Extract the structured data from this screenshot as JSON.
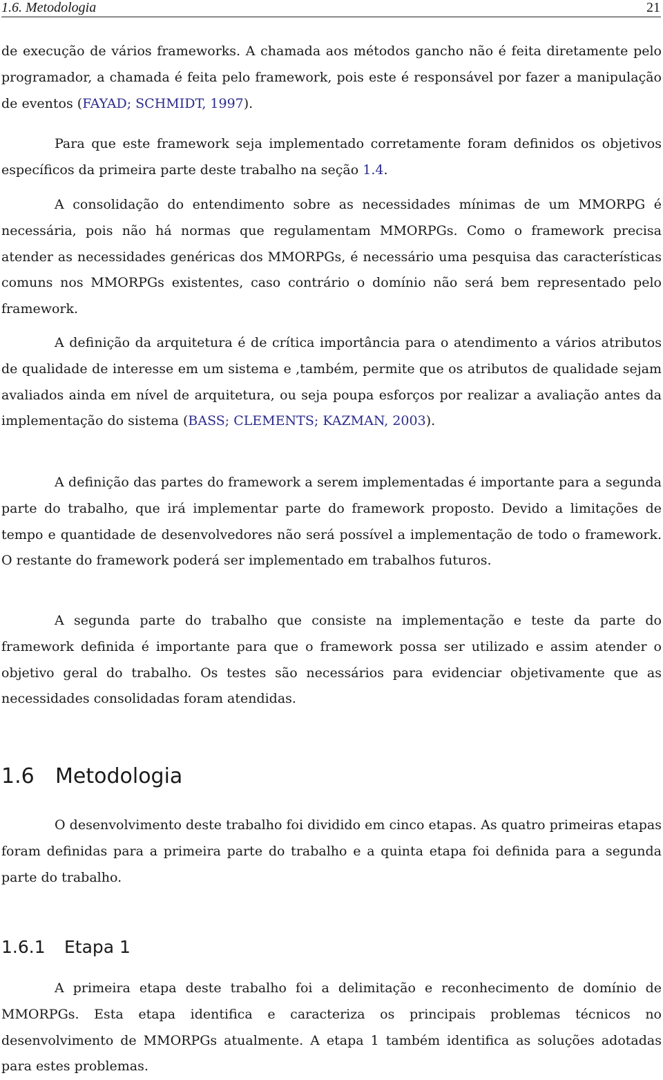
{
  "header": {
    "section": "1.6.  Metodologia",
    "page_number": "21"
  },
  "paragraphs": [
    {
      "text_a": "de execução de vários frameworks. A chamada aos métodos gancho não é feita diretamente pelo programador, a chamada é feita pelo framework, pois este é responsável por fazer a manipulação de eventos (",
      "cite": "FAYAD; SCHMIDT, 1997",
      "text_b": ")."
    },
    {
      "text_a": "Para que este framework seja implementado corretamente foram definidos os objetivos específicos da primeira parte deste trabalho na seção ",
      "cite": "1.4",
      "text_b": "."
    },
    {
      "text": "A consolidação do entendimento sobre as necessidades mínimas de um MMORPG é necessária, pois não há normas que regulamentam MMORPGs. Como o framework precisa atender as necessidades genéricas dos MMORPGs, é necessário uma pesquisa das características comuns nos MMORPGs existentes, caso contrário o domínio não será bem representado pelo framework."
    },
    {
      "text_a": "A definição da arquitetura é de crítica importância para o atendimento a vários atributos de qualidade de interesse em um sistema e ,também, permite que os atributos de qualidade sejam avaliados ainda em nível de arquitetura, ou seja poupa esforços por realizar a avaliação antes da implementação do sistema (",
      "cite": "BASS; CLEMENTS; KAZMAN, 2003",
      "text_b": ")."
    },
    {
      "text": "A definição das partes do framework a serem implementadas é importante para a segunda parte do trabalho, que irá implementar parte do framework proposto. Devido a limitações de tempo e quantidade de desenvolvedores não será possível a implementação de todo o framework. O restante do framework poderá ser implementado em trabalhos futuros."
    },
    {
      "text": "A segunda parte do trabalho que consiste na implementação e teste da parte do framework definida é importante para que o framework possa ser utilizado e assim atender o objetivo geral do trabalho. Os testes são necessários para evidenciar objetivamente que as necessidades consolidadas foram atendidas."
    }
  ],
  "section": {
    "number": "1.6",
    "title": "Metodologia",
    "intro": "O desenvolvimento deste trabalho foi dividido em cinco etapas. As quatro primeiras etapas foram definidas para a primeira parte do trabalho e a quinta etapa foi definida para a segunda parte do trabalho."
  },
  "subsection": {
    "number": "1.6.1",
    "title": "Etapa 1",
    "text": "A primeira etapa deste trabalho foi a delimitação e reconhecimento de domínio de MMORPGs. Esta etapa identifica e caracteriza os principais problemas técnicos no desenvolvimento de MMORPGs atualmente. A etapa 1 também identifica as soluções adotadas para estes problemas."
  },
  "colors": {
    "citation": "#2b2b8c",
    "text": "#1a1a1a"
  }
}
